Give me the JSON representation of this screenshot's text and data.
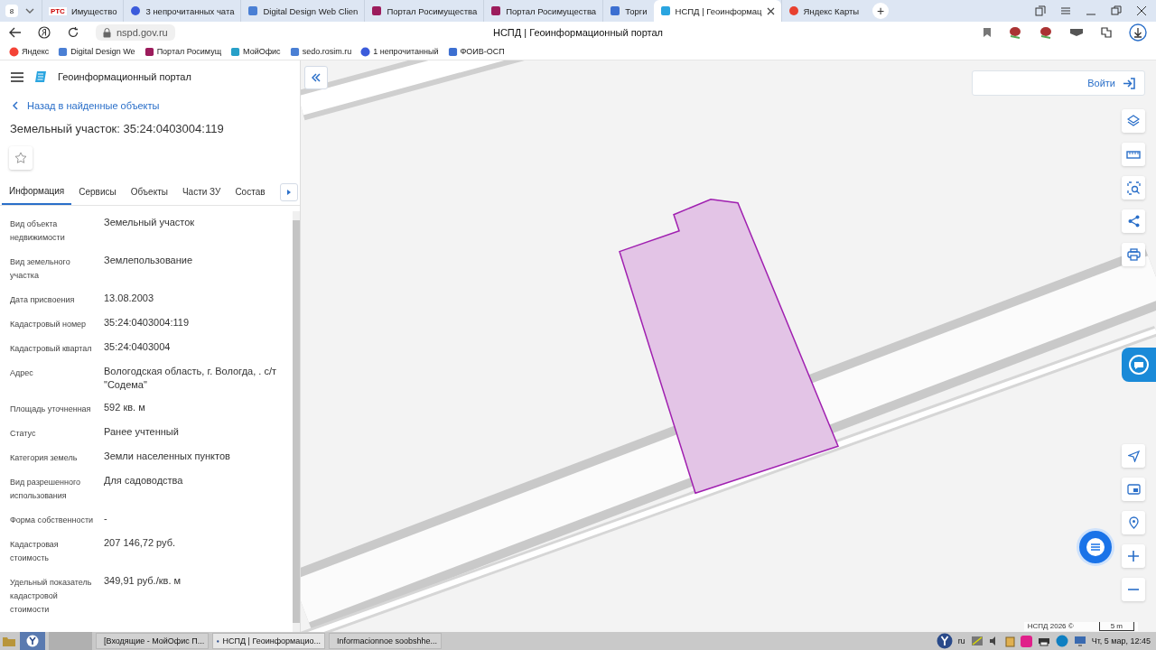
{
  "browser": {
    "tab_count": "8",
    "tabs": [
      {
        "icon_text": "РТС",
        "label": "Имущество",
        "selected": false
      },
      {
        "label": "3 непрочитанных чата",
        "selected": false
      },
      {
        "label": "Digital Design Web Clien",
        "selected": false
      },
      {
        "label": "Портал Росимущества",
        "selected": false
      },
      {
        "label": "Портал Росимущества",
        "selected": false
      },
      {
        "label": "Торги",
        "selected": false
      },
      {
        "label": "НСПД | Геоинформац",
        "selected": true
      },
      {
        "label": "Яндекс Карты",
        "selected": false
      }
    ],
    "new_tab": "+",
    "url": "nspd.gov.ru",
    "page_title": "НСПД | Геоинформационный портал",
    "bookmarks": [
      {
        "label": "Яндекс"
      },
      {
        "label": "Digital Design We"
      },
      {
        "label": "Портал Росимущ"
      },
      {
        "label": "МойОфис"
      },
      {
        "label": "sedo.rosim.ru"
      },
      {
        "label": "1 непрочитанный"
      },
      {
        "label": "ФОИВ-ОСП"
      }
    ]
  },
  "panel": {
    "app_title": "Геоинформационный портал",
    "back_link": "Назад в найденные объекты",
    "object_title": "Земельный участок: 35:24:0403004:119",
    "tabs": [
      {
        "label": "Информация",
        "selected": true
      },
      {
        "label": "Сервисы",
        "selected": false
      },
      {
        "label": "Объекты",
        "selected": false
      },
      {
        "label": "Части ЗУ",
        "selected": false
      },
      {
        "label": "Состав",
        "selected": false
      }
    ],
    "rows": [
      {
        "label": "Вид объекта недвижимости",
        "value": "Земельный участок"
      },
      {
        "label": "Вид земельного участка",
        "value": "Землепользование"
      },
      {
        "label": "Дата присвоения",
        "value": "13.08.2003"
      },
      {
        "label": "Кадастровый номер",
        "value": "35:24:0403004:119"
      },
      {
        "label": "Кадастровый квартал",
        "value": "35:24:0403004"
      },
      {
        "label": "Адрес",
        "value": "Вологодская область, г. Вологда, . с/т \"Содема\""
      },
      {
        "label": "Площадь уточненная",
        "value": "592 кв. м"
      },
      {
        "label": "Статус",
        "value": "Ранее учтенный"
      },
      {
        "label": "Категория земель",
        "value": "Земли населенных пунктов"
      },
      {
        "label": "Вид разрешенного использования",
        "value": "Для садоводства"
      },
      {
        "label": "Форма собственности",
        "value": "-"
      },
      {
        "label": "Кадастровая стоимость",
        "value": "207 146,72 руб."
      },
      {
        "label": "Удельный показатель кадастровой стоимости",
        "value": "349,91 руб./кв. м"
      }
    ]
  },
  "map": {
    "login": "Войти",
    "tools": [
      {
        "kind": "layers"
      },
      {
        "kind": "ruler"
      },
      {
        "kind": "select"
      },
      {
        "kind": "share"
      },
      {
        "kind": "print"
      }
    ],
    "attribution": "НСПД 2026 ©",
    "scale": "5 m"
  },
  "taskbar": {
    "items": [
      {
        "label": "[Входящие - МойОфис П...",
        "selected": false
      },
      {
        "label": "НСПД | Геоинформацио...",
        "selected": true
      },
      {
        "label": "Informacionnoe soobshhe...",
        "selected": false
      }
    ],
    "language": "ru",
    "clock": "Чт, 5 мар, 12:45"
  }
}
